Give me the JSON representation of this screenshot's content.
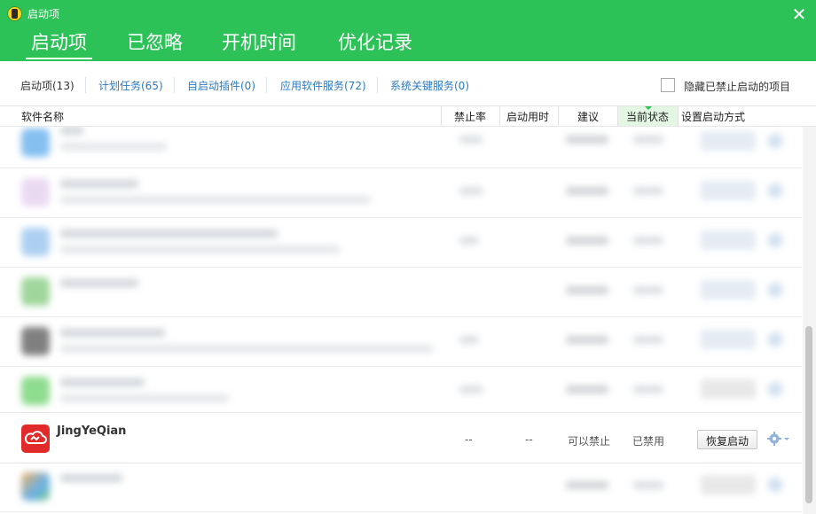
{
  "window": {
    "title": "启动项"
  },
  "tabs": [
    {
      "label": "启动项"
    },
    {
      "label": "已忽略"
    },
    {
      "label": "开机时间"
    },
    {
      "label": "优化记录"
    }
  ],
  "subtabs": [
    {
      "label": "启动项(13)"
    },
    {
      "label": "计划任务(65)"
    },
    {
      "label": "自启动插件(0)"
    },
    {
      "label": "应用软件服务(72)"
    },
    {
      "label": "系统关键服务(0)"
    }
  ],
  "hide_disabled": {
    "label": "隐藏已禁止启动的项目",
    "checked": false
  },
  "columns": {
    "name": "软件名称",
    "disable_rate": "禁止率",
    "boot_time": "启动用时",
    "advice": "建议",
    "status": "当前状态",
    "method": "设置启动方式"
  },
  "focused_row": {
    "name": "JingYeQian",
    "disable_rate": "--",
    "boot_time": "--",
    "advice": "可以禁止",
    "status": "已禁用",
    "action_label": "恢复启动"
  },
  "colors": {
    "brand_green": "#2cc258",
    "link_blue": "#2b7ac1",
    "app_icon_red": "#e12a2a"
  },
  "icons": [
    "app-logo-icon",
    "close-icon",
    "cloud-icon",
    "gear-icon",
    "chevron-down-icon"
  ]
}
